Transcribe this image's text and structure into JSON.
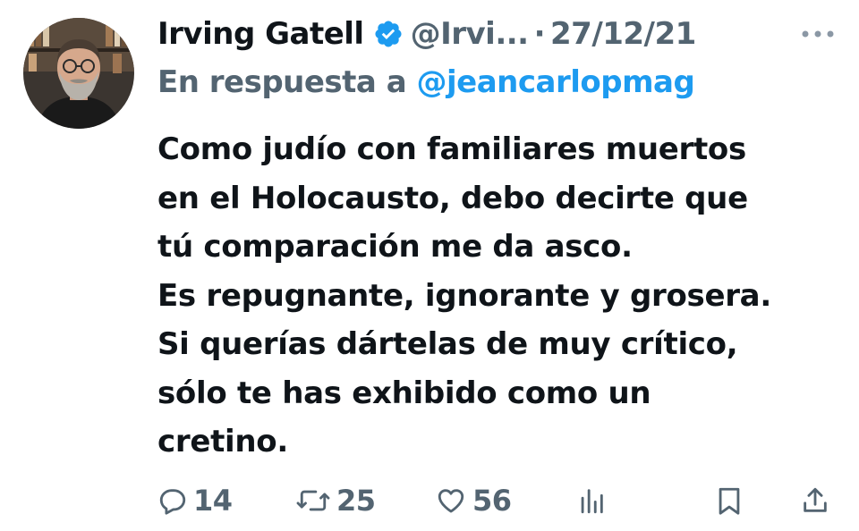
{
  "author": {
    "name": "Irving Gatell",
    "handle": "@Irvi...",
    "separator": "·",
    "date": "27/12/21",
    "verified_icon": "verified-badge-icon",
    "verified_color": "#1d9bf0"
  },
  "reply": {
    "prefix": "En respuesta a",
    "mention": "@jeancarlopmag"
  },
  "tweet": {
    "lines": [
      "Como judío con familiares muertos",
      "en el Holocausto, debo decirte que",
      "tú comparación me da asco.",
      "Es repugnante, ignorante y grosera.",
      "Si querías dártelas de muy crítico,",
      "sólo te has exhibido como un",
      "cretino."
    ]
  },
  "actions": {
    "replies": "14",
    "retweets": "25",
    "likes": "56"
  },
  "colors": {
    "text": "#0f1419",
    "secondary": "#536471",
    "accent": "#1d9bf0"
  }
}
